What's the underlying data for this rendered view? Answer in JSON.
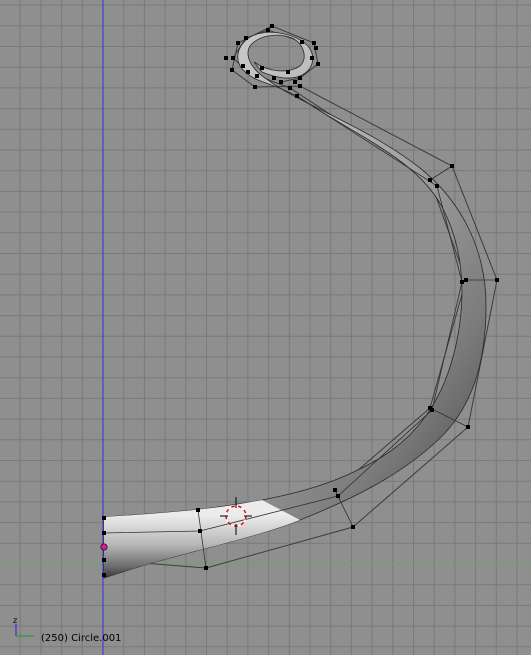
{
  "viewport": {
    "frame_label": "(250)",
    "object_name": "Circle.001",
    "axis_gizmo_label": "z",
    "colors": {
      "background": "#8f8f8f",
      "grid_major": "#7a7a7a",
      "grid_minor": "#868686",
      "x_axis": "#5fae5f",
      "z_axis": "#3232d8",
      "control_point": "#000000",
      "curve_origin": "#d02090",
      "cursor_red": "#dd0000"
    }
  },
  "status": {
    "text": "(250) Circle.001"
  }
}
